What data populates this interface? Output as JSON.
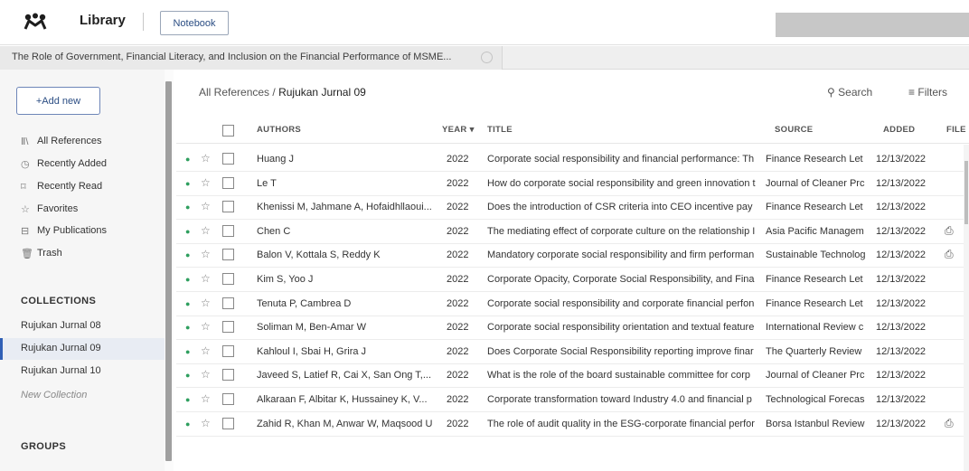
{
  "header": {
    "library_label": "Library",
    "notebook_label": "Notebook",
    "logo_icon": "mendeley-logo-icon"
  },
  "doc_tab": {
    "title": "The Role of Government, Financial Literacy, and Inclusion on the Financial Performance of MSME..."
  },
  "sidebar": {
    "add_new_label": "+Add new",
    "nav": [
      {
        "label": "All References",
        "icon": "all-references-icon"
      },
      {
        "label": "Recently Added",
        "icon": "clock-icon"
      },
      {
        "label": "Recently Read",
        "icon": "bookmark-icon"
      },
      {
        "label": "Favorites",
        "icon": "star-icon"
      },
      {
        "label": "My Publications",
        "icon": "publications-icon"
      },
      {
        "label": "Trash",
        "icon": "trash-icon"
      }
    ],
    "collections_heading": "COLLECTIONS",
    "collections": [
      "Rujukan Jurnal 08",
      "Rujukan Jurnal 09",
      "Rujukan Jurnal 10"
    ],
    "active_collection": "Rujukan Jurnal 09",
    "new_collection_label": "New Collection",
    "groups_heading": "GROUPS"
  },
  "main": {
    "breadcrumb_root": "All References",
    "breadcrumb_sep": "/",
    "breadcrumb_current": "Rujukan Jurnal 09",
    "search_label": "Search",
    "filters_label": "Filters",
    "columns": {
      "authors": "AUTHORS",
      "year": "YEAR",
      "title": "TITLE",
      "source": "SOURCE",
      "added": "ADDED",
      "file": "FILE"
    },
    "rows": [
      {
        "authors": "Huang J",
        "year": "2022",
        "title": "Corporate social responsibility and financial performance: Th",
        "source": "Finance Research Let",
        "added": "12/13/2022",
        "file": ""
      },
      {
        "authors": "Le T",
        "year": "2022",
        "title": "How do corporate social responsibility and green innovation t",
        "source": "Journal of Cleaner Prc",
        "added": "12/13/2022",
        "file": ""
      },
      {
        "authors": "Khenissi M, Jahmane A, Hofaidhllaoui...",
        "year": "2022",
        "title": "Does the introduction of CSR criteria into CEO incentive pay",
        "source": "Finance Research Let",
        "added": "12/13/2022",
        "file": ""
      },
      {
        "authors": "Chen C",
        "year": "2022",
        "title": "The mediating effect of corporate culture on the relationship I",
        "source": "Asia Pacific Managem",
        "added": "12/13/2022",
        "file": "file-icon"
      },
      {
        "authors": "Balon V, Kottala S, Reddy K",
        "year": "2022",
        "title": "Mandatory corporate social responsibility and firm performan",
        "source": "Sustainable Technolog",
        "added": "12/13/2022",
        "file": "file-icon"
      },
      {
        "authors": "Kim S, Yoo J",
        "year": "2022",
        "title": "Corporate Opacity, Corporate Social Responsibility, and Fina",
        "source": "Finance Research Let",
        "added": "12/13/2022",
        "file": ""
      },
      {
        "authors": "Tenuta P, Cambrea D",
        "year": "2022",
        "title": "Corporate social responsibility and corporate financial perfon",
        "source": "Finance Research Let",
        "added": "12/13/2022",
        "file": ""
      },
      {
        "authors": "Soliman M, Ben-Amar W",
        "year": "2022",
        "title": "Corporate social responsibility orientation and textual feature",
        "source": "International Review c",
        "added": "12/13/2022",
        "file": ""
      },
      {
        "authors": "Kahloul I, Sbai H, Grira J",
        "year": "2022",
        "title": "Does Corporate Social Responsibility reporting improve finar",
        "source": "The Quarterly Review",
        "added": "12/13/2022",
        "file": ""
      },
      {
        "authors": "Javeed S, Latief R, Cai X, San Ong T,...",
        "year": "2022",
        "title": "What is the role of the board sustainable committee for corp",
        "source": "Journal of Cleaner Prc",
        "added": "12/13/2022",
        "file": ""
      },
      {
        "authors": "Alkaraan F, Albitar K, Hussainey K, V...",
        "year": "2022",
        "title": "Corporate transformation toward Industry 4.0 and financial p",
        "source": "Technological Forecas",
        "added": "12/13/2022",
        "file": ""
      },
      {
        "authors": "Zahid R, Khan M, Anwar W, Maqsood U",
        "year": "2022",
        "title": "The role of audit quality in the ESG-corporate financial perfor",
        "source": "Borsa Istanbul Review",
        "added": "12/13/2022",
        "file": "file-icon"
      }
    ]
  },
  "colors": {
    "accent": "#2f5fb5",
    "unread_dot": "#2f9f5f",
    "brand_text": "#2b4d83"
  }
}
